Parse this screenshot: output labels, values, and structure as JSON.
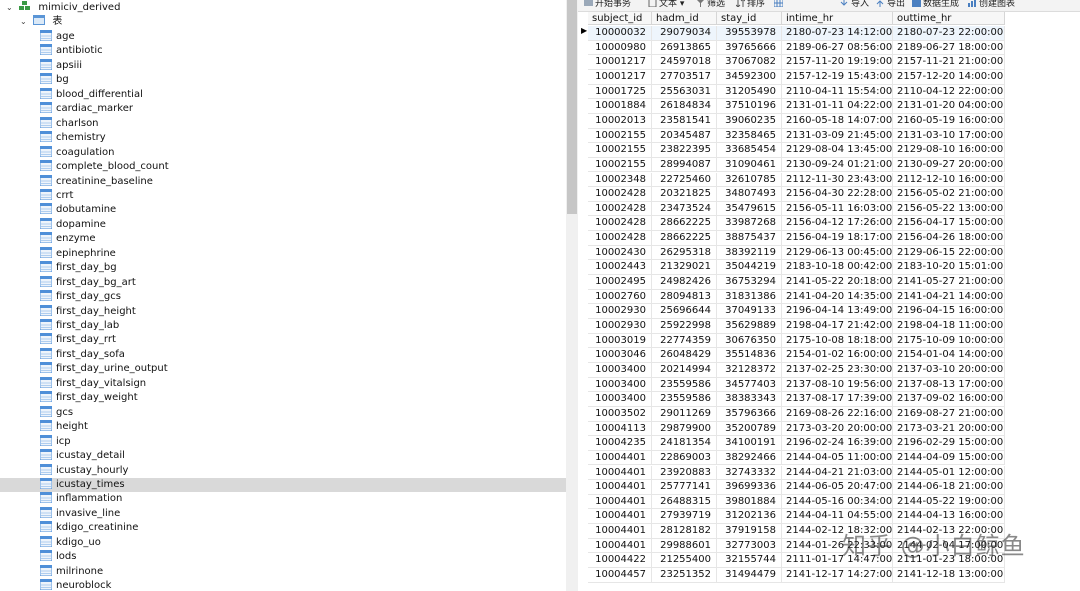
{
  "navigator": {
    "database": "mimiciv_derived",
    "tables_folder": "表",
    "selected_table": "icustay_times",
    "tables": [
      "age",
      "antibiotic",
      "apsiii",
      "bg",
      "blood_differential",
      "cardiac_marker",
      "charlson",
      "chemistry",
      "coagulation",
      "complete_blood_count",
      "creatinine_baseline",
      "crrt",
      "dobutamine",
      "dopamine",
      "enzyme",
      "epinephrine",
      "first_day_bg",
      "first_day_bg_art",
      "first_day_gcs",
      "first_day_height",
      "first_day_lab",
      "first_day_rrt",
      "first_day_sofa",
      "first_day_urine_output",
      "first_day_vitalsign",
      "first_day_weight",
      "gcs",
      "height",
      "icp",
      "icustay_detail",
      "icustay_hourly",
      "icustay_times",
      "inflammation",
      "invasive_line",
      "kdigo_creatinine",
      "kdigo_uo",
      "lods",
      "milrinone",
      "neuroblock"
    ]
  },
  "toolbar": {
    "begin_transaction": "开始事务",
    "text": "文本",
    "filter": "筛选",
    "sort": "排序",
    "columns_icon": "grid-icon",
    "import": "导入",
    "export": "导出",
    "data_generation": "数据生成",
    "create_chart": "创建图表"
  },
  "grid": {
    "columns": [
      "subject_id",
      "hadm_id",
      "stay_id",
      "intime_hr",
      "outtime_hr"
    ],
    "rows": [
      [
        "10000032",
        "29079034",
        "39553978",
        "2180-07-23 14:12:00",
        "2180-07-23 22:00:00"
      ],
      [
        "10000980",
        "26913865",
        "39765666",
        "2189-06-27 08:56:00",
        "2189-06-27 18:00:00"
      ],
      [
        "10001217",
        "24597018",
        "37067082",
        "2157-11-20 19:19:00",
        "2157-11-21 21:00:00"
      ],
      [
        "10001217",
        "27703517",
        "34592300",
        "2157-12-19 15:43:00",
        "2157-12-20 14:00:00"
      ],
      [
        "10001725",
        "25563031",
        "31205490",
        "2110-04-11 15:54:00",
        "2110-04-12 22:00:00"
      ],
      [
        "10001884",
        "26184834",
        "37510196",
        "2131-01-11 04:22:00",
        "2131-01-20 04:00:00"
      ],
      [
        "10002013",
        "23581541",
        "39060235",
        "2160-05-18 14:07:00",
        "2160-05-19 16:00:00"
      ],
      [
        "10002155",
        "20345487",
        "32358465",
        "2131-03-09 21:45:00",
        "2131-03-10 17:00:00"
      ],
      [
        "10002155",
        "23822395",
        "33685454",
        "2129-08-04 13:45:00",
        "2129-08-10 16:00:00"
      ],
      [
        "10002155",
        "28994087",
        "31090461",
        "2130-09-24 01:21:00",
        "2130-09-27 20:00:00"
      ],
      [
        "10002348",
        "22725460",
        "32610785",
        "2112-11-30 23:43:00",
        "2112-12-10 16:00:00"
      ],
      [
        "10002428",
        "20321825",
        "34807493",
        "2156-04-30 22:28:00",
        "2156-05-02 21:00:00"
      ],
      [
        "10002428",
        "23473524",
        "35479615",
        "2156-05-11 16:03:00",
        "2156-05-22 13:00:00"
      ],
      [
        "10002428",
        "28662225",
        "33987268",
        "2156-04-12 17:26:00",
        "2156-04-17 15:00:00"
      ],
      [
        "10002428",
        "28662225",
        "38875437",
        "2156-04-19 18:17:00",
        "2156-04-26 18:00:00"
      ],
      [
        "10002430",
        "26295318",
        "38392119",
        "2129-06-13 00:45:00",
        "2129-06-15 22:00:00"
      ],
      [
        "10002443",
        "21329021",
        "35044219",
        "2183-10-18 00:42:00",
        "2183-10-20 15:01:00"
      ],
      [
        "10002495",
        "24982426",
        "36753294",
        "2141-05-22 20:18:00",
        "2141-05-27 21:00:00"
      ],
      [
        "10002760",
        "28094813",
        "31831386",
        "2141-04-20 14:35:00",
        "2141-04-21 14:00:00"
      ],
      [
        "10002930",
        "25696644",
        "37049133",
        "2196-04-14 13:49:00",
        "2196-04-15 16:00:00"
      ],
      [
        "10002930",
        "25922998",
        "35629889",
        "2198-04-17 21:42:00",
        "2198-04-18 11:00:00"
      ],
      [
        "10003019",
        "22774359",
        "30676350",
        "2175-10-08 18:18:00",
        "2175-10-09 10:00:00"
      ],
      [
        "10003046",
        "26048429",
        "35514836",
        "2154-01-02 16:00:00",
        "2154-01-04 14:00:00"
      ],
      [
        "10003400",
        "20214994",
        "32128372",
        "2137-02-25 23:30:00",
        "2137-03-10 20:00:00"
      ],
      [
        "10003400",
        "23559586",
        "34577403",
        "2137-08-10 19:56:00",
        "2137-08-13 17:00:00"
      ],
      [
        "10003400",
        "23559586",
        "38383343",
        "2137-08-17 17:39:00",
        "2137-09-02 16:00:00"
      ],
      [
        "10003502",
        "29011269",
        "35796366",
        "2169-08-26 22:16:00",
        "2169-08-27 21:00:00"
      ],
      [
        "10004113",
        "29879900",
        "35200789",
        "2173-03-20 20:00:00",
        "2173-03-21 20:00:00"
      ],
      [
        "10004235",
        "24181354",
        "34100191",
        "2196-02-24 16:39:00",
        "2196-02-29 15:00:00"
      ],
      [
        "10004401",
        "22869003",
        "38292466",
        "2144-04-05 11:00:00",
        "2144-04-09 15:00:00"
      ],
      [
        "10004401",
        "23920883",
        "32743332",
        "2144-04-21 21:03:00",
        "2144-05-01 12:00:00"
      ],
      [
        "10004401",
        "25777141",
        "39699336",
        "2144-06-05 20:47:00",
        "2144-06-18 21:00:00"
      ],
      [
        "10004401",
        "26488315",
        "39801884",
        "2144-05-16 00:34:00",
        "2144-05-22 19:00:00"
      ],
      [
        "10004401",
        "27939719",
        "31202136",
        "2144-04-11 04:55:00",
        "2144-04-13 16:00:00"
      ],
      [
        "10004401",
        "28128182",
        "37919158",
        "2144-02-12 18:32:00",
        "2144-02-13 22:00:00"
      ],
      [
        "10004401",
        "29988601",
        "32773003",
        "2144-01-26 22:33:00",
        "2144-02-04 17:00:00"
      ],
      [
        "10004422",
        "21255400",
        "32155744",
        "2111-01-17 14:47:00",
        "2111-01-23 18:00:00"
      ],
      [
        "10004457",
        "23251352",
        "31494479",
        "2141-12-17 14:27:00",
        "2141-12-18 13:00:00"
      ]
    ]
  },
  "watermark": "知乎 @小白鲸鱼"
}
